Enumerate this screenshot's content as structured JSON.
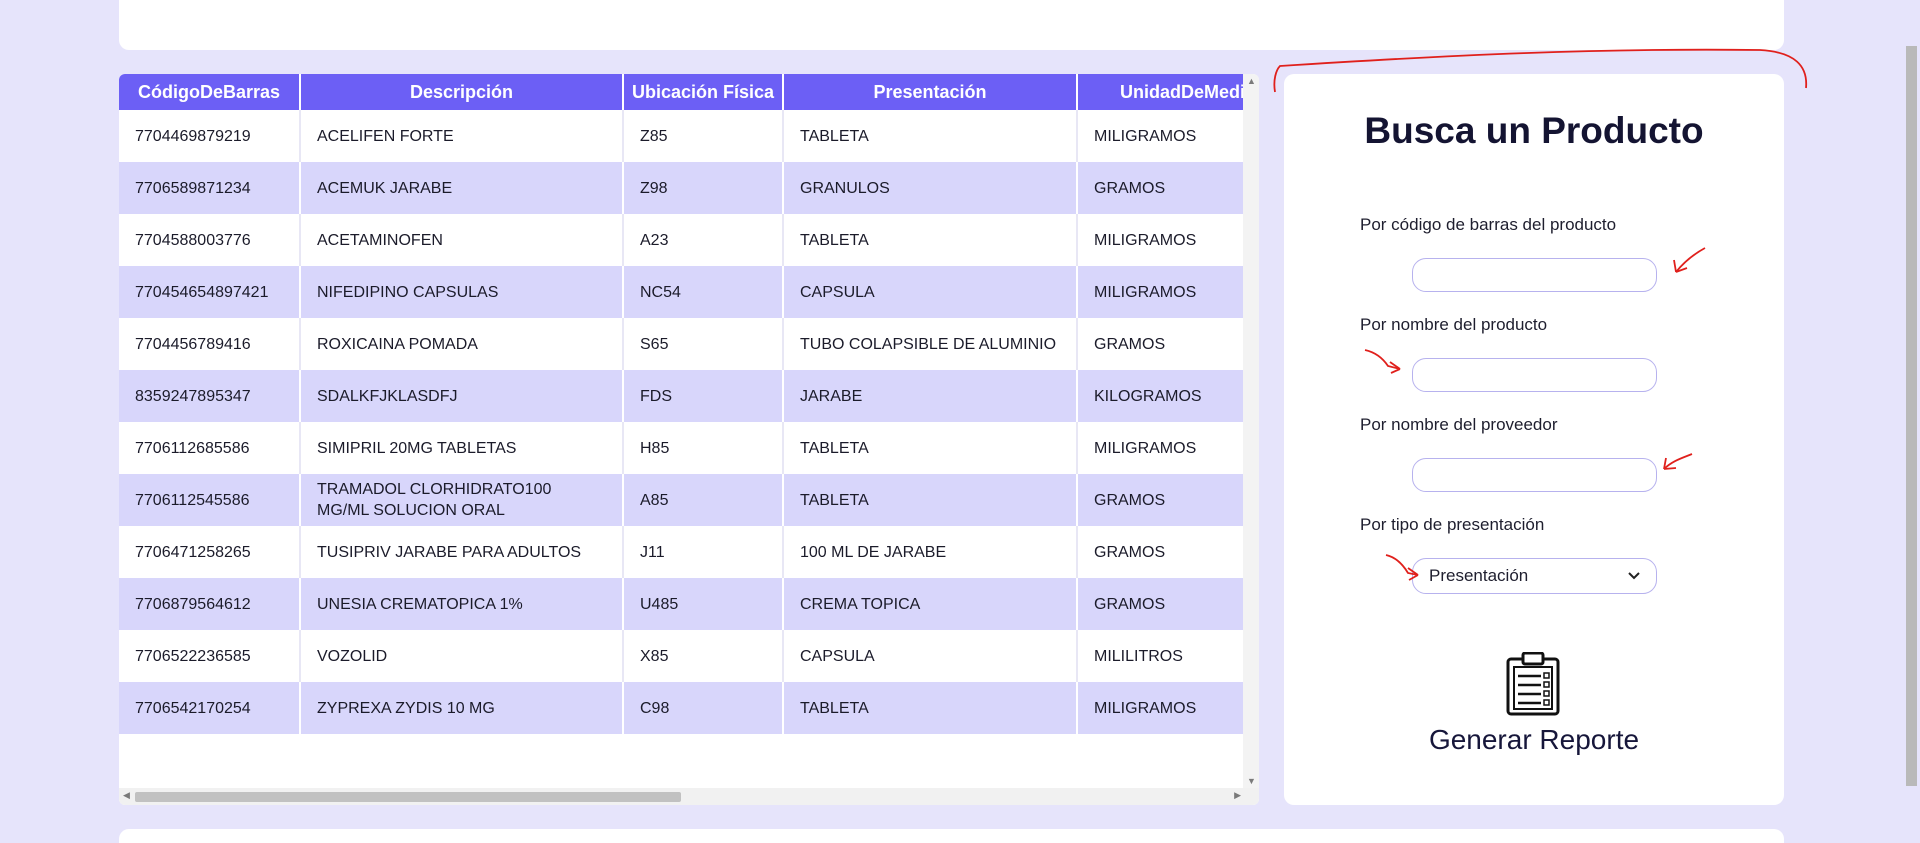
{
  "table": {
    "columns": [
      "CódigoDeBarras",
      "Descripción",
      "Ubicación Física",
      "Presentación",
      "UnidadDeMedida"
    ],
    "rows": [
      [
        "7704469879219",
        "ACELIFEN FORTE",
        "Z85",
        "TABLETA",
        "MILIGRAMOS"
      ],
      [
        "7706589871234",
        "ACEMUK JARABE",
        "Z98",
        "GRANULOS",
        "GRAMOS"
      ],
      [
        "7704588003776",
        "ACETAMINOFEN",
        "A23",
        "TABLETA",
        "MILIGRAMOS"
      ],
      [
        "770454654897421",
        "NIFEDIPINO CAPSULAS",
        "NC54",
        "CAPSULA",
        "MILIGRAMOS"
      ],
      [
        "7704456789416",
        "ROXICAINA POMADA",
        "S65",
        "TUBO COLAPSIBLE DE ALUMINIO",
        "GRAMOS"
      ],
      [
        "8359247895347",
        "SDALKFJKLASDFJ",
        "FDS",
        "JARABE",
        "KILOGRAMOS"
      ],
      [
        "7706112685586",
        "SIMIPRIL 20MG TABLETAS",
        "H85",
        "TABLETA",
        "MILIGRAMOS"
      ],
      [
        "7706112545586",
        "TRAMADOL CLORHIDRATO100 MG/ML SOLUCION ORAL",
        "A85",
        "TABLETA",
        "GRAMOS"
      ],
      [
        "7706471258265",
        "TUSIPRIV JARABE PARA ADULTOS",
        "J11",
        "100 ML DE JARABE",
        "GRAMOS"
      ],
      [
        "7706879564612",
        "UNESIA CREMATOPICA 1%",
        "U485",
        "CREMA TOPICA",
        "GRAMOS"
      ],
      [
        "7706522236585",
        "VOZOLID",
        "X85",
        "CAPSULA",
        "MILILITROS"
      ],
      [
        "7706542170254",
        "ZYPREXA ZYDIS 10 MG",
        "C98",
        "TABLETA",
        "MILIGRAMOS"
      ]
    ]
  },
  "search": {
    "title": "Busca un Producto",
    "fields": {
      "barcode_label": "Por código de barras del producto",
      "name_label": "Por nombre del producto",
      "provider_label": "Por nombre del proveedor",
      "presentation_label": "Por tipo de presentación",
      "presentation_value": "Presentación"
    },
    "report_label": "Generar Reporte"
  },
  "colors": {
    "page_background": "#e6e4fb",
    "table_header": "#6c5ff5",
    "row_alt": "#d8d6fb",
    "annotation": "#e0201c"
  },
  "icons": [
    "clipboard-report-icon",
    "scroll-arrow-up-icon",
    "scroll-arrow-down-icon",
    "scroll-arrow-left-icon",
    "scroll-arrow-right-icon",
    "select-chevron-icon"
  ]
}
